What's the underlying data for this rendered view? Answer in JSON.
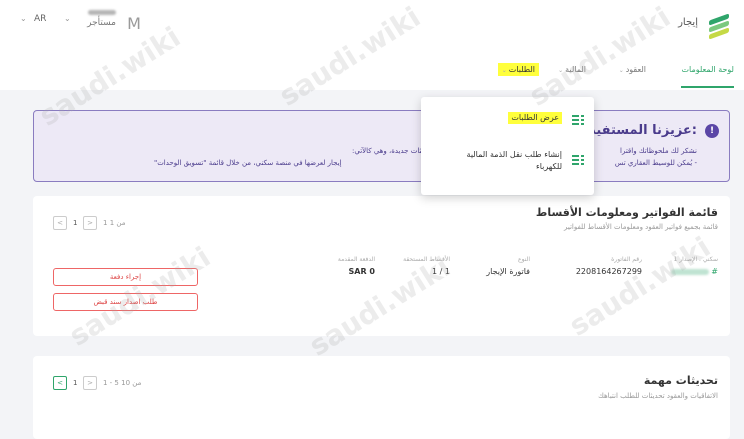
{
  "header": {
    "brand": "إيجار",
    "language": "AR",
    "user_role": "مستأجر",
    "avatar_letter": "M"
  },
  "nav": {
    "items": [
      {
        "label": "لوحة المعلومات"
      },
      {
        "label": "العقود"
      },
      {
        "label": "المالية"
      },
      {
        "label": "الطلبات"
      }
    ]
  },
  "dropdown": {
    "items": [
      {
        "label": "عرض الطلبات"
      },
      {
        "label": "إنشاء طلب نقل الذمة المالية للكهرباء"
      }
    ]
  },
  "banner": {
    "icon": "!",
    "title": "عزيزنا المستفيد:",
    "line1": "نشكر لك ملحوظاتك واقترا",
    "line2": "- يُمكن للوسيط العقاري تس",
    "line1_cont": "حديثات جديدة، وهي كالآتي:",
    "line2_cont": "إيجار لعرضها في منصة سكني، من خلال قائمة \"تسويق الوحدات\""
  },
  "invoices": {
    "title": "قائمة الفواتير ومعلومات الأقساط",
    "subtitle": "قائمة بجميع فواتير العقود ومعلومات الأقساط للفواتير",
    "pager": {
      "page": "1",
      "text": "1 من 1"
    },
    "fields": [
      {
        "label": "سكني . الإصدار 1",
        "value": "#"
      },
      {
        "label": "رقم الفاتورة",
        "value": "2208164267299"
      },
      {
        "label": "النوع",
        "value": "فاتورة الإيجار"
      },
      {
        "label": "الأقساط المستحقة",
        "value": "1 / 1"
      },
      {
        "label": "الدفعة المقدمة",
        "value": "SAR 0"
      }
    ],
    "buttons": {
      "pay": "إجراء دفعة",
      "receipt": "طلب اصدار سند قبض"
    }
  },
  "updates": {
    "title": "تحديثات مهمة",
    "subtitle": "الاتفاقيات والعقود تحديثات للطلب انتباهك",
    "pager": {
      "page": "1",
      "text": "1 - 5 من 10"
    }
  },
  "watermark": "saudi.wiki",
  "colors": {
    "accent": "#2fa56b",
    "banner": "#5b46a6",
    "highlight": "#ffff3c",
    "danger": "#dd4444"
  }
}
